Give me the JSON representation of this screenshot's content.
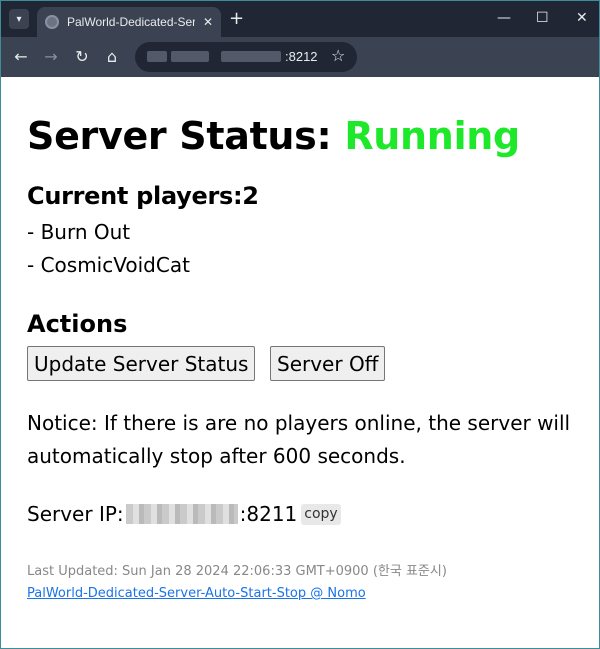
{
  "browser": {
    "tab_menu_icon": "chevron-down-icon",
    "tab_title": "PalWorld-Dedicated-Server",
    "tab_close_glyph": "✕",
    "new_tab_glyph": "+",
    "url_port": ":8212",
    "controls": {
      "minimize": "—",
      "maximize": "☐",
      "close": "✕"
    },
    "nav": {
      "back": "←",
      "forward": "→",
      "reload": "↻",
      "home": "⌂",
      "bookmark": "☆"
    }
  },
  "page": {
    "title_prefix": "Server Status: ",
    "status": "Running",
    "status_color": "#1ee82a",
    "players_heading": "Current players:2",
    "players": [
      "- Burn Out",
      "- CosmicVoidCat"
    ],
    "actions_heading": "Actions",
    "buttons": {
      "update": "Update Server Status",
      "off": "Server Off"
    },
    "notice": "Notice: If there is are no players online, the server will automatically stop after 600 seconds.",
    "ip_label": "Server IP:",
    "ip_port": ":8211",
    "copy_label": "copy",
    "last_updated": "Last Updated: Sun Jan 28 2024 22:06:33 GMT+0900 (한국 표준시)",
    "footer_link": "PalWorld-Dedicated-Server-Auto-Start-Stop @ Nomo",
    "link_color": "#1a73e8"
  }
}
